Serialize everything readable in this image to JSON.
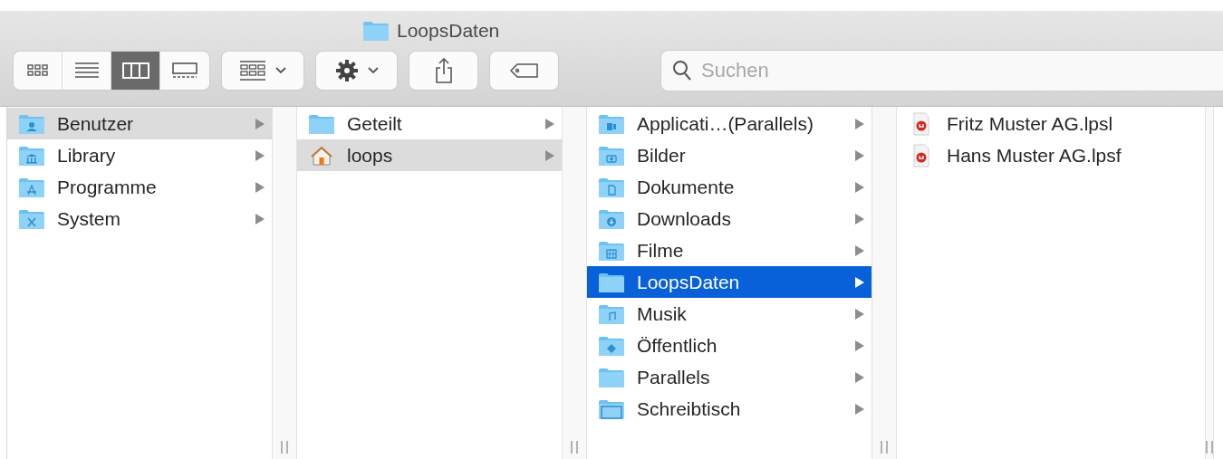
{
  "window": {
    "title": "LoopsDaten"
  },
  "toolbar": {
    "views": [
      {
        "kind": "icons",
        "selected": false
      },
      {
        "kind": "list",
        "selected": false
      },
      {
        "kind": "columns",
        "selected": true
      },
      {
        "kind": "gallery",
        "selected": false
      }
    ]
  },
  "search": {
    "placeholder": "Suchen"
  },
  "columns": [
    {
      "items": [
        {
          "name": "Benutzer",
          "kind": "users",
          "selected": true
        },
        {
          "name": "Library",
          "kind": "library",
          "selected": false
        },
        {
          "name": "Programme",
          "kind": "apps",
          "selected": false
        },
        {
          "name": "System",
          "kind": "system",
          "selected": false
        }
      ]
    },
    {
      "items": [
        {
          "name": "Geteilt",
          "kind": "plain",
          "selected": false
        },
        {
          "name": "loops",
          "kind": "home",
          "selected": true
        }
      ]
    },
    {
      "items": [
        {
          "name": "Applicati…(Parallels)",
          "kind": "parallels",
          "selected": false
        },
        {
          "name": "Bilder",
          "kind": "pictures",
          "selected": false
        },
        {
          "name": "Dokumente",
          "kind": "documents",
          "selected": false
        },
        {
          "name": "Downloads",
          "kind": "downloads",
          "selected": false
        },
        {
          "name": "Filme",
          "kind": "movies",
          "selected": false
        },
        {
          "name": "LoopsDaten",
          "kind": "plain",
          "selected": true
        },
        {
          "name": "Musik",
          "kind": "music",
          "selected": false
        },
        {
          "name": "Öffentlich",
          "kind": "public",
          "selected": false
        },
        {
          "name": "Parallels",
          "kind": "plain",
          "selected": false
        },
        {
          "name": "Schreibtisch",
          "kind": "desktop",
          "selected": false
        }
      ]
    },
    {
      "items": [
        {
          "name": "Fritz Muster AG.lpsl",
          "kind": "file",
          "selected": false
        },
        {
          "name": "Hans Muster AG.lpsf",
          "kind": "file",
          "selected": false
        }
      ]
    }
  ]
}
